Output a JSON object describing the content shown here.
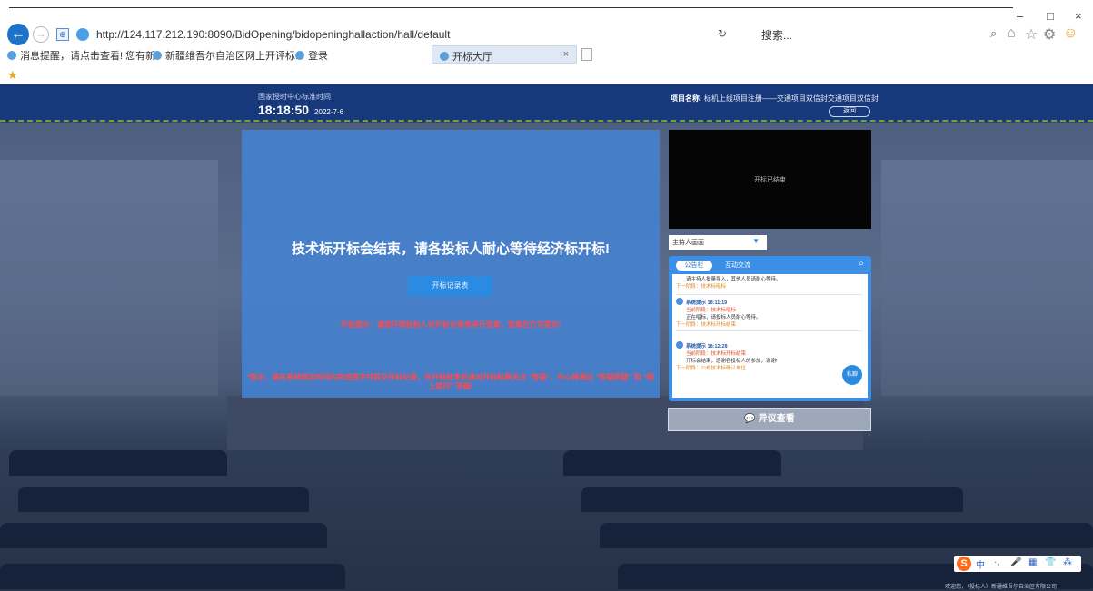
{
  "browser": {
    "url": "http://124.117.212.190:8090/BidOpening/bidopeninghallaction/hall/default",
    "search_placeholder": "搜索...",
    "refresh_symbol": "↻",
    "bookmarks": [
      "消息提醒，请点击查看! 您有新",
      "新疆维吾尔自治区网上开评标...",
      "登录"
    ],
    "active_tab": "开标大厅",
    "tab_close": "×",
    "window_controls": [
      "–",
      "□",
      "×"
    ]
  },
  "header": {
    "time_label": "国家授时中心标准时间",
    "time": "18:18:50",
    "date": "2022-7-6",
    "project_label": "项目名称:",
    "project_name": "标机上线项目注册——交通项目双信封交通项目双信封",
    "back_button": "返回"
  },
  "notice": {
    "title": "技术标开标会结束，请各投标人耐心等待经济标开标!",
    "record_button": "开标记录表",
    "warning1": "开标提示：请您仔细投标人对开标记录表进行签章，签章后方可提交!",
    "warning2": "*提示：请在系统规定时间内完成签字并提交开标记录，在开标结束后请对开标结果关注 “答疑”，中心将通过 “答疑质疑” 和 “网上提问” 答疑!"
  },
  "video": {
    "status": "开标已结束"
  },
  "host_select": {
    "value": "主持人画面"
  },
  "chat": {
    "tab_active": "公告栏",
    "tab_other": "互动交流",
    "messages": [
      {
        "top_line": "请主持人批量导入，其他人员请耐心等待。",
        "next": "下一阶段：技术标唱标"
      },
      {
        "who": "系统提示 18:11:19",
        "stage": "当前阶段：技术标唱标",
        "text": "正在唱标，请投标人员耐心等待。",
        "next": "下一阶段：技术标开标结束"
      },
      {
        "who": "系统提示 18:12:28",
        "stage": "当前阶段：技术标开标结束",
        "text": "开标会结束，感谢各投标人的参加，谢谢!",
        "next": "下一阶段：公布技术标确认单位"
      }
    ],
    "fab": "私聊"
  },
  "objection_button": "异议查看",
  "ime": {
    "logo": "S",
    "items": [
      "中",
      "·,",
      "🎤",
      "▦",
      "👕",
      "⁂"
    ]
  },
  "footer": "欢迎您，（投标人）新疆维吾尔自治区有限公司"
}
